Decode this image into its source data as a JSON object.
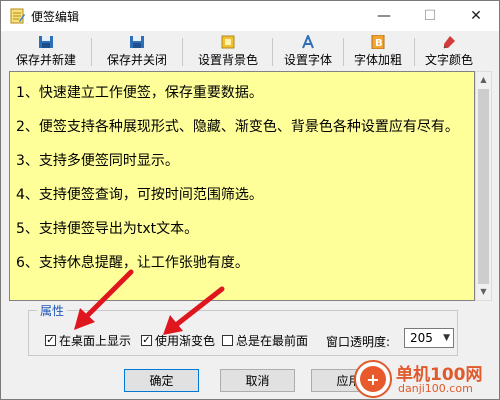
{
  "window": {
    "title": "便签编辑",
    "icon": "note-app-icon",
    "controls": [
      "minimize",
      "maximize",
      "close"
    ]
  },
  "toolbar": {
    "items": [
      {
        "label": "保存并新建",
        "icon": "save-new-icon"
      },
      {
        "label": "保存并关闭",
        "icon": "save-close-icon"
      },
      {
        "label": "设置背景色",
        "icon": "background-color-icon"
      },
      {
        "label": "设置字体",
        "icon": "font-icon"
      },
      {
        "label": "字体加粗",
        "icon": "bold-icon"
      },
      {
        "label": "文字颜色",
        "icon": "text-color-icon"
      }
    ]
  },
  "editor": {
    "background": "#ffff99",
    "lines": [
      "1、快速建立工作便签，保存重要数据。",
      "2、便签支持各种展现形式、隐藏、渐变色、背景色各种设置应有尽有。",
      "3、支持多便签同时显示。",
      "4、支持便签查询，可按时间范围筛选。",
      "5、支持便签导出为txt文本。",
      "6、支持休息提醒，让工作张驰有度。"
    ]
  },
  "properties": {
    "legend": "属性",
    "show_on_desktop": {
      "label": "在桌面上显示",
      "checked": true
    },
    "use_gradient": {
      "label": "使用渐变色",
      "checked": true
    },
    "always_on_top": {
      "label": "总是在最前面",
      "checked": false
    },
    "opacity_label": "窗口透明度:",
    "opacity_value": "205"
  },
  "buttons": {
    "ok": "确定",
    "cancel": "取消",
    "apply": "应用"
  },
  "watermark": {
    "name": "单机100网",
    "url": "danji100.com",
    "color": "#e05a2b"
  },
  "annotation_color": "#e0161e"
}
